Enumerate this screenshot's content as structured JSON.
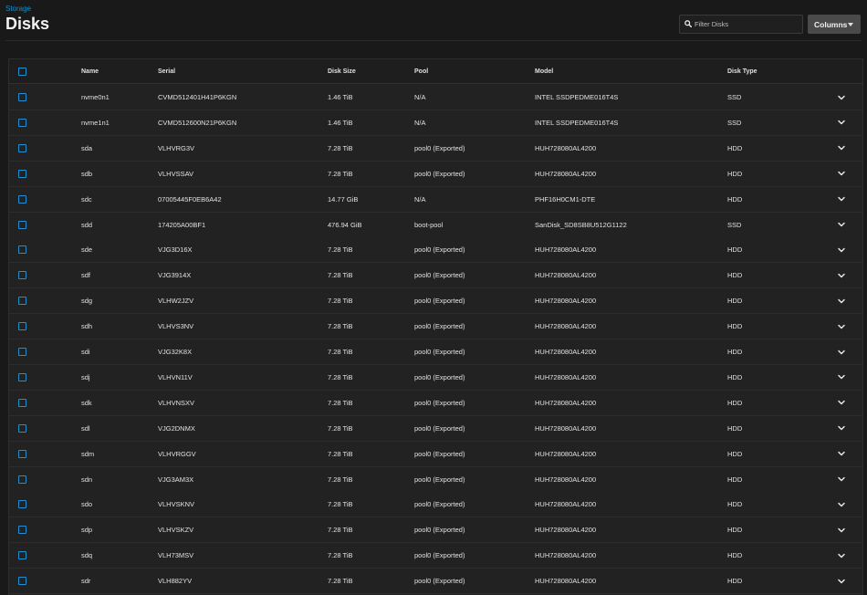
{
  "breadcrumb": "Storage",
  "title": "Disks",
  "search": {
    "placeholder": "Filter Disks",
    "icon": "search-icon"
  },
  "columns_button": "Columns",
  "accent": "#0095d5",
  "headers": {
    "name": "Name",
    "serial": "Serial",
    "size": "Disk Size",
    "pool": "Pool",
    "model": "Model",
    "type": "Disk Type"
  },
  "rows": [
    {
      "name": "nvme0n1",
      "serial": "CVMD512401H41P6KGN",
      "size": "1.46 TiB",
      "pool": "N/A",
      "model": "INTEL SSDPEDME016T4S",
      "type": "SSD"
    },
    {
      "name": "nvme1n1",
      "serial": "CVMD512600N21P6KGN",
      "size": "1.46 TiB",
      "pool": "N/A",
      "model": "INTEL SSDPEDME016T4S",
      "type": "SSD"
    },
    {
      "name": "sda",
      "serial": "VLHVRG3V",
      "size": "7.28 TiB",
      "pool": "pool0 (Exported)",
      "model": "HUH728080AL4200",
      "type": "HDD"
    },
    {
      "name": "sdb",
      "serial": "VLHVSSAV",
      "size": "7.28 TiB",
      "pool": "pool0 (Exported)",
      "model": "HUH728080AL4200",
      "type": "HDD"
    },
    {
      "name": "sdc",
      "serial": "07005445F0EB6A42",
      "size": "14.77 GiB",
      "pool": "N/A",
      "model": "PHF16H0CM1-DTE",
      "type": "HDD"
    },
    {
      "name": "sdd",
      "serial": "174205A00BF1",
      "size": "476.94 GiB",
      "pool": "boot-pool",
      "model": "SanDisk_SD8SB8U512G1122",
      "type": "SSD"
    },
    {
      "name": "sde",
      "serial": "VJG3D16X",
      "size": "7.28 TiB",
      "pool": "pool0 (Exported)",
      "model": "HUH728080AL4200",
      "type": "HDD"
    },
    {
      "name": "sdf",
      "serial": "VJG3914X",
      "size": "7.28 TiB",
      "pool": "pool0 (Exported)",
      "model": "HUH728080AL4200",
      "type": "HDD"
    },
    {
      "name": "sdg",
      "serial": "VLHW2JZV",
      "size": "7.28 TiB",
      "pool": "pool0 (Exported)",
      "model": "HUH728080AL4200",
      "type": "HDD"
    },
    {
      "name": "sdh",
      "serial": "VLHVS3NV",
      "size": "7.28 TiB",
      "pool": "pool0 (Exported)",
      "model": "HUH728080AL4200",
      "type": "HDD"
    },
    {
      "name": "sdi",
      "serial": "VJG32K8X",
      "size": "7.28 TiB",
      "pool": "pool0 (Exported)",
      "model": "HUH728080AL4200",
      "type": "HDD"
    },
    {
      "name": "sdj",
      "serial": "VLHVN11V",
      "size": "7.28 TiB",
      "pool": "pool0 (Exported)",
      "model": "HUH728080AL4200",
      "type": "HDD"
    },
    {
      "name": "sdk",
      "serial": "VLHVNSXV",
      "size": "7.28 TiB",
      "pool": "pool0 (Exported)",
      "model": "HUH728080AL4200",
      "type": "HDD"
    },
    {
      "name": "sdl",
      "serial": "VJG2DNMX",
      "size": "7.28 TiB",
      "pool": "pool0 (Exported)",
      "model": "HUH728080AL4200",
      "type": "HDD"
    },
    {
      "name": "sdm",
      "serial": "VLHVRGGV",
      "size": "7.28 TiB",
      "pool": "pool0 (Exported)",
      "model": "HUH728080AL4200",
      "type": "HDD"
    },
    {
      "name": "sdn",
      "serial": "VJG3AM3X",
      "size": "7.28 TiB",
      "pool": "pool0 (Exported)",
      "model": "HUH728080AL4200",
      "type": "HDD"
    },
    {
      "name": "sdo",
      "serial": "VLHVSKNV",
      "size": "7.28 TiB",
      "pool": "pool0 (Exported)",
      "model": "HUH728080AL4200",
      "type": "HDD"
    },
    {
      "name": "sdp",
      "serial": "VLHVSKZV",
      "size": "7.28 TiB",
      "pool": "pool0 (Exported)",
      "model": "HUH728080AL4200",
      "type": "HDD"
    },
    {
      "name": "sdq",
      "serial": "VLH73MSV",
      "size": "7.28 TiB",
      "pool": "pool0 (Exported)",
      "model": "HUH728080AL4200",
      "type": "HDD"
    },
    {
      "name": "sdr",
      "serial": "VLH882YV",
      "size": "7.28 TiB",
      "pool": "pool0 (Exported)",
      "model": "HUH728080AL4200",
      "type": "HDD"
    }
  ]
}
